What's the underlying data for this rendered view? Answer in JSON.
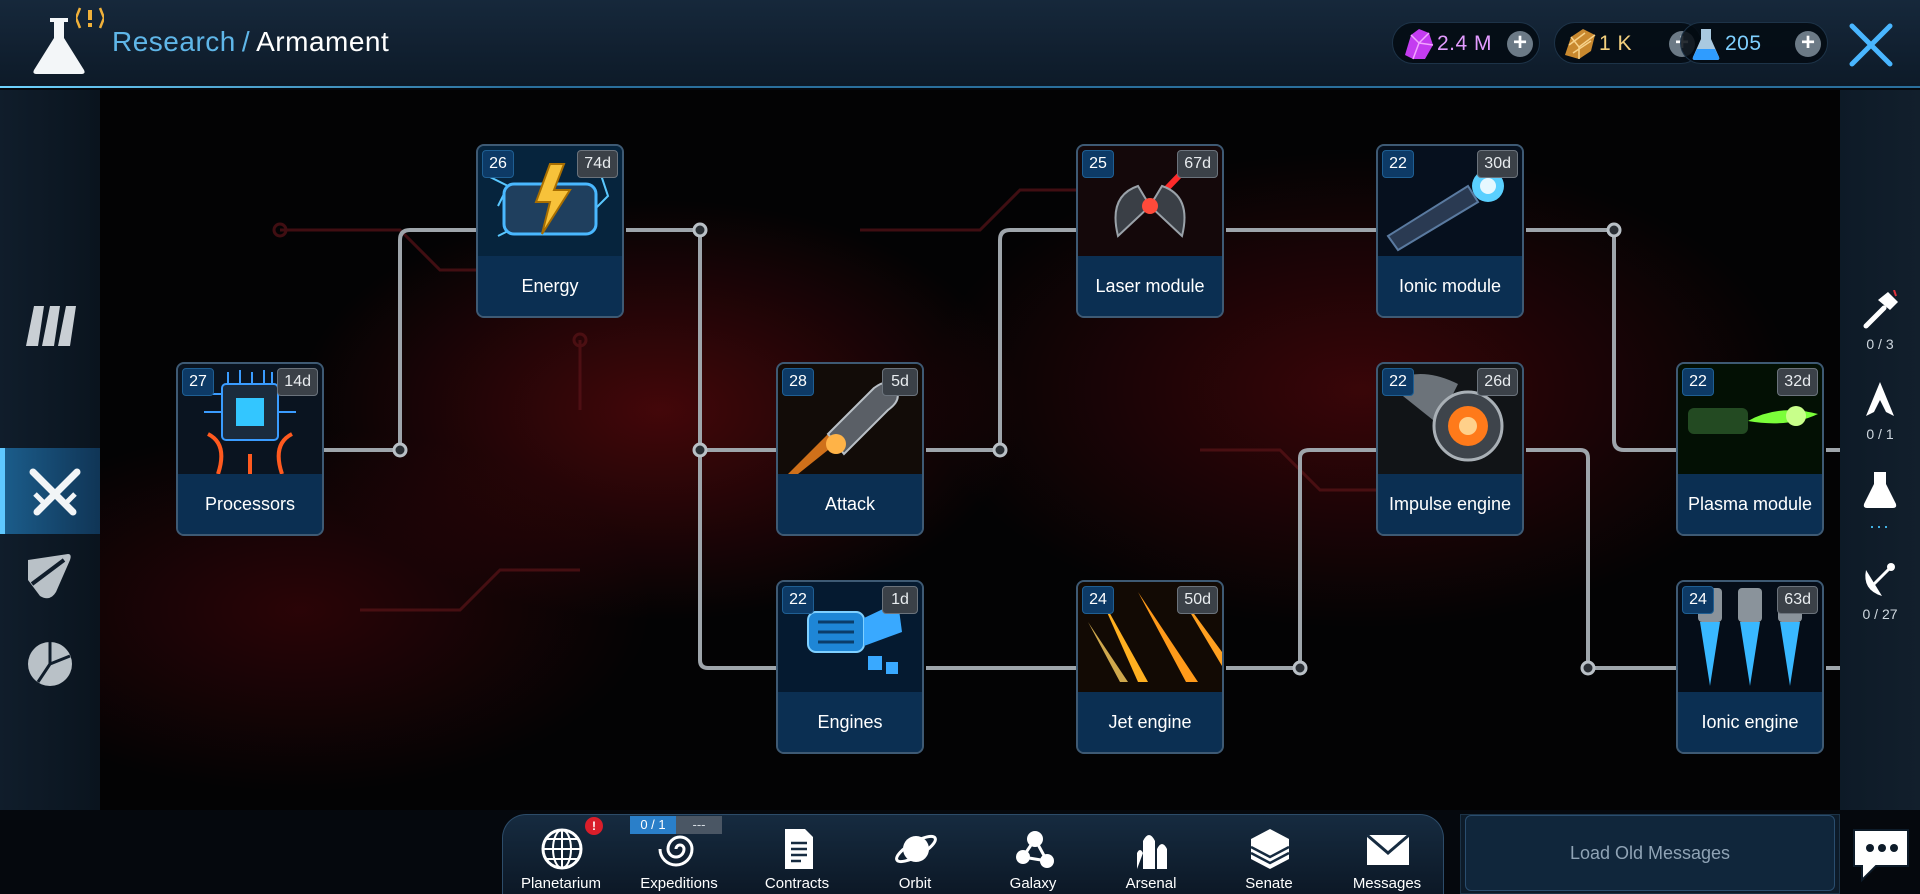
{
  "header": {
    "breadcrumb_parent": "Research",
    "breadcrumb_sep": "/",
    "breadcrumb_current": "Armament",
    "resources": [
      {
        "name": "crystal",
        "value": "2.4 M",
        "color": "#d45cff"
      },
      {
        "name": "gold",
        "value": "1 K",
        "color": "#e0a040"
      },
      {
        "name": "research-flask",
        "value": "205",
        "color": "#4ab8ff"
      }
    ]
  },
  "tree": {
    "nodes": [
      {
        "id": "processors",
        "level": "27",
        "time": "14d",
        "label": "Processors"
      },
      {
        "id": "energy",
        "level": "26",
        "time": "74d",
        "label": "Energy"
      },
      {
        "id": "attack",
        "level": "28",
        "time": "5d",
        "label": "Attack"
      },
      {
        "id": "engines",
        "level": "22",
        "time": "1d",
        "label": "Engines"
      },
      {
        "id": "laser",
        "level": "25",
        "time": "67d",
        "label": "Laser module"
      },
      {
        "id": "jet",
        "level": "24",
        "time": "50d",
        "label": "Jet engine"
      },
      {
        "id": "ionicmod",
        "level": "22",
        "time": "30d",
        "label": "Ionic module"
      },
      {
        "id": "impulse",
        "level": "22",
        "time": "26d",
        "label": "Impulse engine"
      },
      {
        "id": "plasma",
        "level": "22",
        "time": "32d",
        "label": "Plasma module"
      },
      {
        "id": "ioniceng",
        "level": "24",
        "time": "63d",
        "label": "Ionic engine"
      }
    ]
  },
  "right_panel": [
    {
      "icon": "hammer-icon",
      "count": "0 / 3"
    },
    {
      "icon": "ship-icon",
      "count": "0 / 1"
    },
    {
      "icon": "flask-icon",
      "count": "..."
    },
    {
      "icon": "satellite-dish-icon",
      "count": "0 / 27"
    }
  ],
  "bottom_nav": {
    "items": [
      {
        "id": "planetarium",
        "label": "Planetarium"
      },
      {
        "id": "expeditions",
        "label": "Expeditions"
      },
      {
        "id": "contracts",
        "label": "Contracts"
      },
      {
        "id": "orbit",
        "label": "Orbit"
      },
      {
        "id": "galaxy",
        "label": "Galaxy"
      },
      {
        "id": "arsenal",
        "label": "Arsenal"
      },
      {
        "id": "senate",
        "label": "Senate"
      },
      {
        "id": "messages",
        "label": "Messages"
      }
    ],
    "planetarium_alert": "!",
    "expeditions_count": "0 / 1",
    "expeditions_extra": "---"
  },
  "messages": {
    "load_old": "Load Old Messages"
  }
}
